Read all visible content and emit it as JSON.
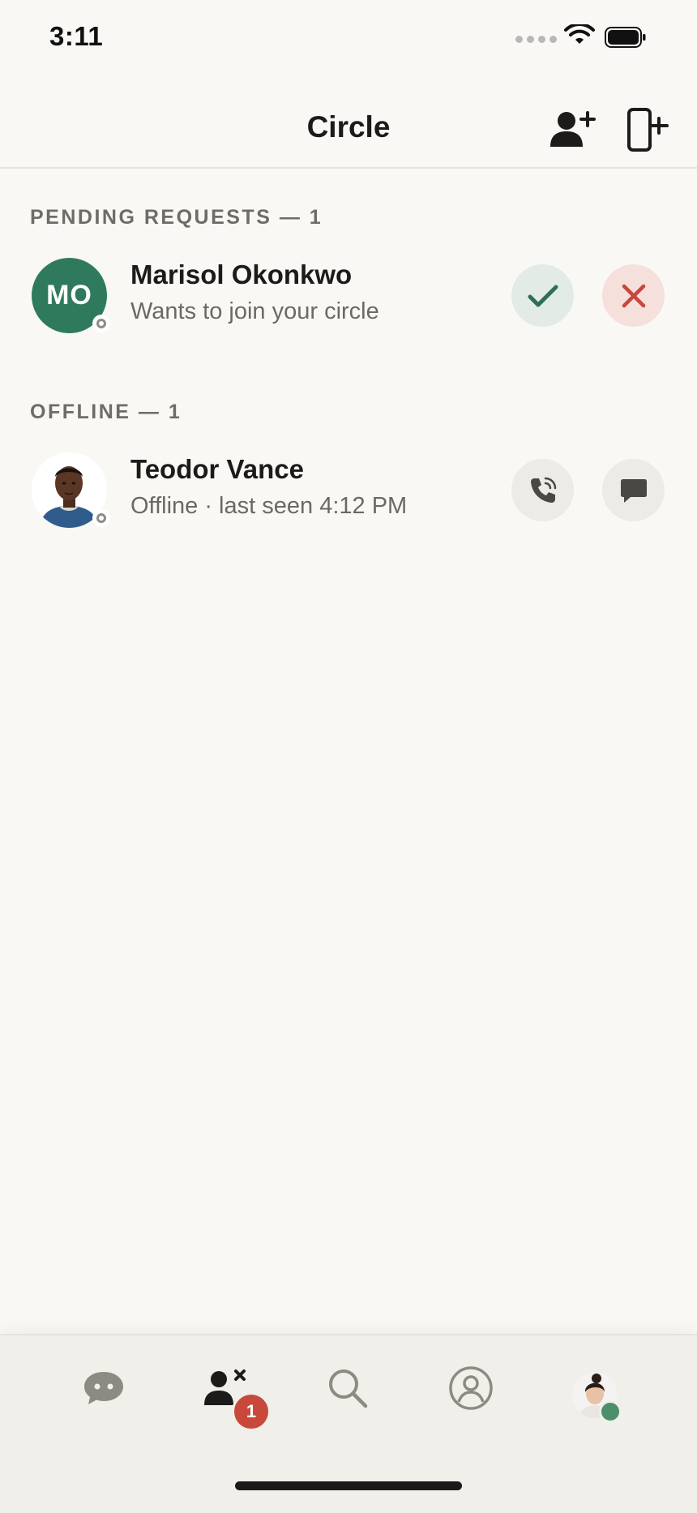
{
  "status_bar": {
    "time": "3:11"
  },
  "header": {
    "title": "Circle",
    "add_contact_icon": "person-add-icon",
    "add_device_icon": "device-add-icon"
  },
  "pending": {
    "section_label": "PENDING REQUESTS — 1",
    "items": [
      {
        "initials": "MO",
        "name": "Marisol Okonkwo",
        "subtitle": "Wants to join your circle",
        "avatar_color": "#2f7a5d",
        "presence": "offline"
      }
    ]
  },
  "offline": {
    "section_label": "OFFLINE — 1",
    "items": [
      {
        "name": "Teodor Vance",
        "subtitle": "Offline · last seen 4:12 PM",
        "presence": "offline"
      }
    ]
  },
  "tabs": {
    "items": [
      {
        "name": "chats",
        "icon": "chat-bubble-icon"
      },
      {
        "name": "circle",
        "icon": "people-icon",
        "badge": "1",
        "active": true
      },
      {
        "name": "search",
        "icon": "search-icon"
      },
      {
        "name": "profile",
        "icon": "user-circle-icon"
      },
      {
        "name": "account",
        "icon": "avatar-icon",
        "online": true
      }
    ]
  },
  "colors": {
    "accept": "#2f6e55",
    "decline": "#c9463d",
    "accent": "#2f7a5d",
    "badge": "#c8493c",
    "online": "#4c8f6b"
  }
}
